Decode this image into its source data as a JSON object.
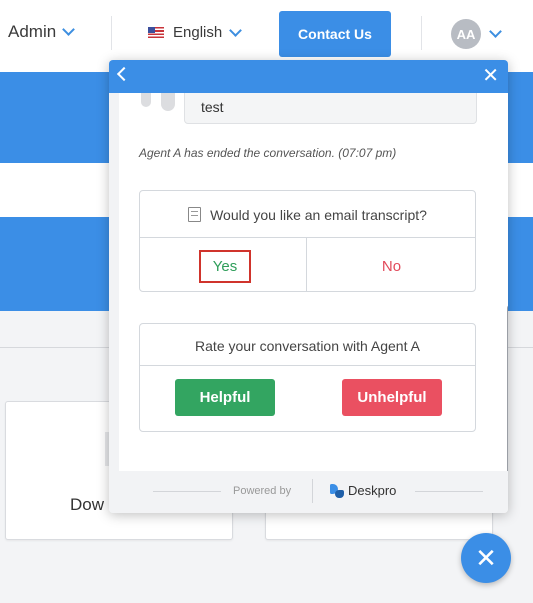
{
  "header": {
    "admin_label": "Admin",
    "language_label": "English",
    "contact_label": "Contact Us",
    "avatar_initials": "AA"
  },
  "background": {
    "card_text": "Dow"
  },
  "chat": {
    "message_text": "test",
    "system_note": "Agent A has ended the conversation. (07:07 pm)",
    "transcript": {
      "question": "Would you like an email transcript?",
      "yes_label": "Yes",
      "no_label": "No"
    },
    "rating": {
      "question": "Rate your conversation with Agent A",
      "helpful_label": "Helpful",
      "unhelpful_label": "Unhelpful"
    },
    "footer": {
      "powered_by": "Powered by",
      "brand": "Deskpro"
    }
  },
  "colors": {
    "accent": "#3b8ee6",
    "helpful": "#33a561",
    "unhelpful": "#ea5061",
    "yes_text": "#2f9e5a",
    "no_text": "#e24a5b",
    "focus_outline": "#d0342c"
  },
  "icons": {
    "admin_chevron": "chevron-down-icon",
    "language_flag": "us-flag-icon",
    "close": "close-icon",
    "back": "chevron-left-icon",
    "transcript": "document-icon",
    "brand_logo": "deskpro-logo-icon"
  }
}
